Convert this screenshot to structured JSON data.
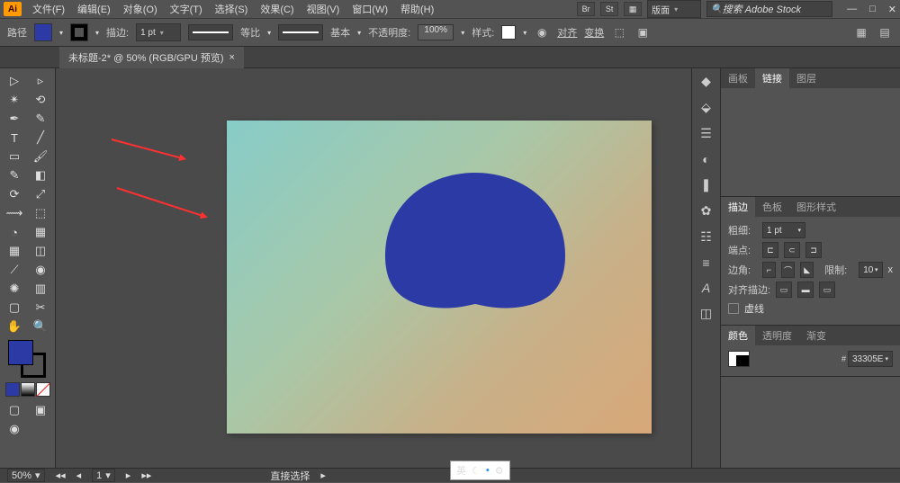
{
  "app": {
    "logo": "Ai"
  },
  "menu": [
    "文件(F)",
    "编辑(E)",
    "对象(O)",
    "文字(T)",
    "选择(S)",
    "效果(C)",
    "视图(V)",
    "窗口(W)",
    "帮助(H)"
  ],
  "titlebar": {
    "workspace": "版面",
    "search_placeholder": "搜索 Adobe Stock",
    "badges": [
      "Br",
      "St"
    ]
  },
  "control": {
    "path_label": "路径",
    "fill_color": "#2b3aa5",
    "stroke_color": "#000000",
    "stroke_label": "描边:",
    "stroke_weight": "1 pt",
    "profile_label": "等比",
    "brush_label": "基本",
    "opacity_label": "不透明度:",
    "opacity_value": "100%",
    "style_label": "样式:",
    "align_label": "对齐",
    "transform_label": "变换"
  },
  "document": {
    "tab_title": "未标题-2* @ 50% (RGB/GPU 预览)",
    "close": "×"
  },
  "panels": {
    "p1_tabs": [
      "画板",
      "链接",
      "图层"
    ],
    "stroke": {
      "tabs": [
        "描边",
        "色板",
        "图形样式"
      ],
      "weight_label": "粗细:",
      "weight_value": "1 pt",
      "cap_label": "端点:",
      "corner_label": "边角:",
      "limit_label": "限制:",
      "limit_value": "10",
      "limit_unit": "x",
      "align_label": "对齐描边:",
      "dashed_label": "虚线"
    },
    "color": {
      "tabs": [
        "颜色",
        "透明度",
        "渐变"
      ],
      "hex_value": "33305E"
    }
  },
  "statusbar": {
    "zoom": "50%",
    "artboard_nav": "1",
    "tool_hint": "直接选择"
  },
  "ime": {
    "lang": "英",
    "moon": "☾",
    "gear": "⚙"
  }
}
